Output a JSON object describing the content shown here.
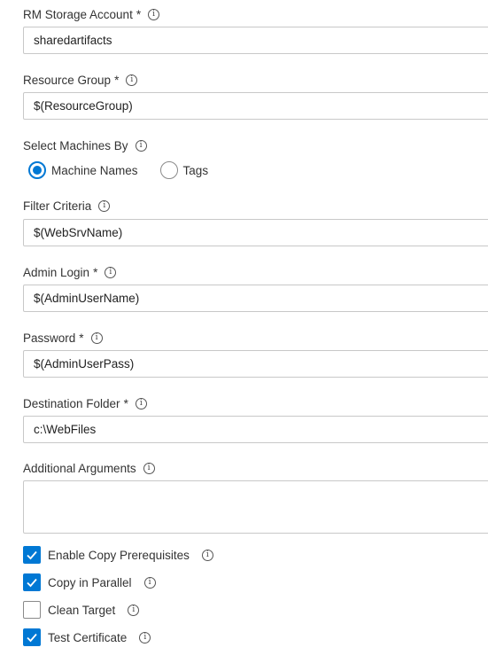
{
  "fields": {
    "rm_storage": {
      "label": "RM Storage Account",
      "required": "*",
      "value": "sharedartifacts"
    },
    "resource_group": {
      "label": "Resource Group",
      "required": "*",
      "value": "$(ResourceGroup)"
    },
    "select_machines": {
      "label": "Select Machines By",
      "options": [
        "Machine Names",
        "Tags"
      ],
      "selected": "Machine Names"
    },
    "filter_criteria": {
      "label": "Filter Criteria",
      "value": "$(WebSrvName)"
    },
    "admin_login": {
      "label": "Admin Login",
      "required": "*",
      "value": "$(AdminUserName)"
    },
    "password": {
      "label": "Password",
      "required": "*",
      "value": "$(AdminUserPass)"
    },
    "destination_folder": {
      "label": "Destination Folder",
      "required": "*",
      "value": "c:\\WebFiles"
    },
    "additional_arguments": {
      "label": "Additional Arguments",
      "value": ""
    }
  },
  "checkboxes": [
    {
      "label": "Enable Copy Prerequisites",
      "checked": true
    },
    {
      "label": "Copy in Parallel",
      "checked": true
    },
    {
      "label": "Clean Target",
      "checked": false
    },
    {
      "label": "Test Certificate",
      "checked": true
    }
  ],
  "info_glyph": "i",
  "icons": {
    "info": "info-icon",
    "check": "checkmark-icon"
  },
  "colors": {
    "accent": "#0078d4",
    "border": "#c8c8c8",
    "text": "#333333"
  }
}
